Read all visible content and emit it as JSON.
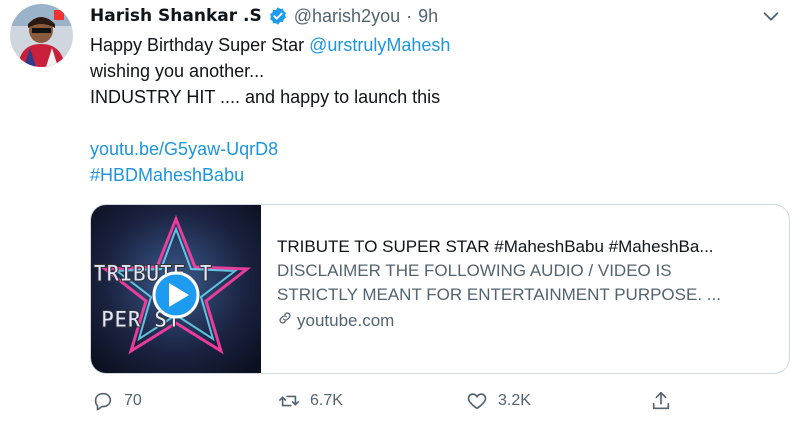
{
  "author": {
    "name": "Harish Shankar .S",
    "handle": "@harish2you",
    "separator": "·",
    "time": "9h"
  },
  "tweet": {
    "line1_prefix": "Happy Birthday Super Star ",
    "line1_mention": "@urstrulyMahesh",
    "line2": "wishing you another...",
    "line3": "INDUSTRY HIT .... and happy to launch this",
    "link": "youtu.be/G5yaw-UqrD8",
    "hashtag": "#HBDMaheshBabu"
  },
  "card": {
    "title": "TRIBUTE TO SUPER STAR #MaheshBabu #MaheshBa...",
    "description_line1": "DISCLAIMER THE FOLLOWING AUDIO / VIDEO IS",
    "description_line2": "STRICTLY MEANT FOR ENTERTAINMENT PURPOSE. ...",
    "domain": "youtube.com",
    "thumbnail_text_top": "TRIBUTE T",
    "thumbnail_text_bottom": "PER ST"
  },
  "actions": {
    "replies": "70",
    "retweets": "6.7K",
    "likes": "3.2K"
  },
  "colors": {
    "link": "#1b95e0",
    "verified": "#1d9bf0",
    "secondary_text": "#536471",
    "play_button": "#1d9bf0"
  },
  "icons": {
    "verified": "verified-badge-icon",
    "more": "chevron-down-icon",
    "reply": "reply-icon",
    "retweet": "retweet-icon",
    "like": "heart-icon",
    "share": "share-icon",
    "link": "link-icon",
    "play": "play-icon"
  }
}
